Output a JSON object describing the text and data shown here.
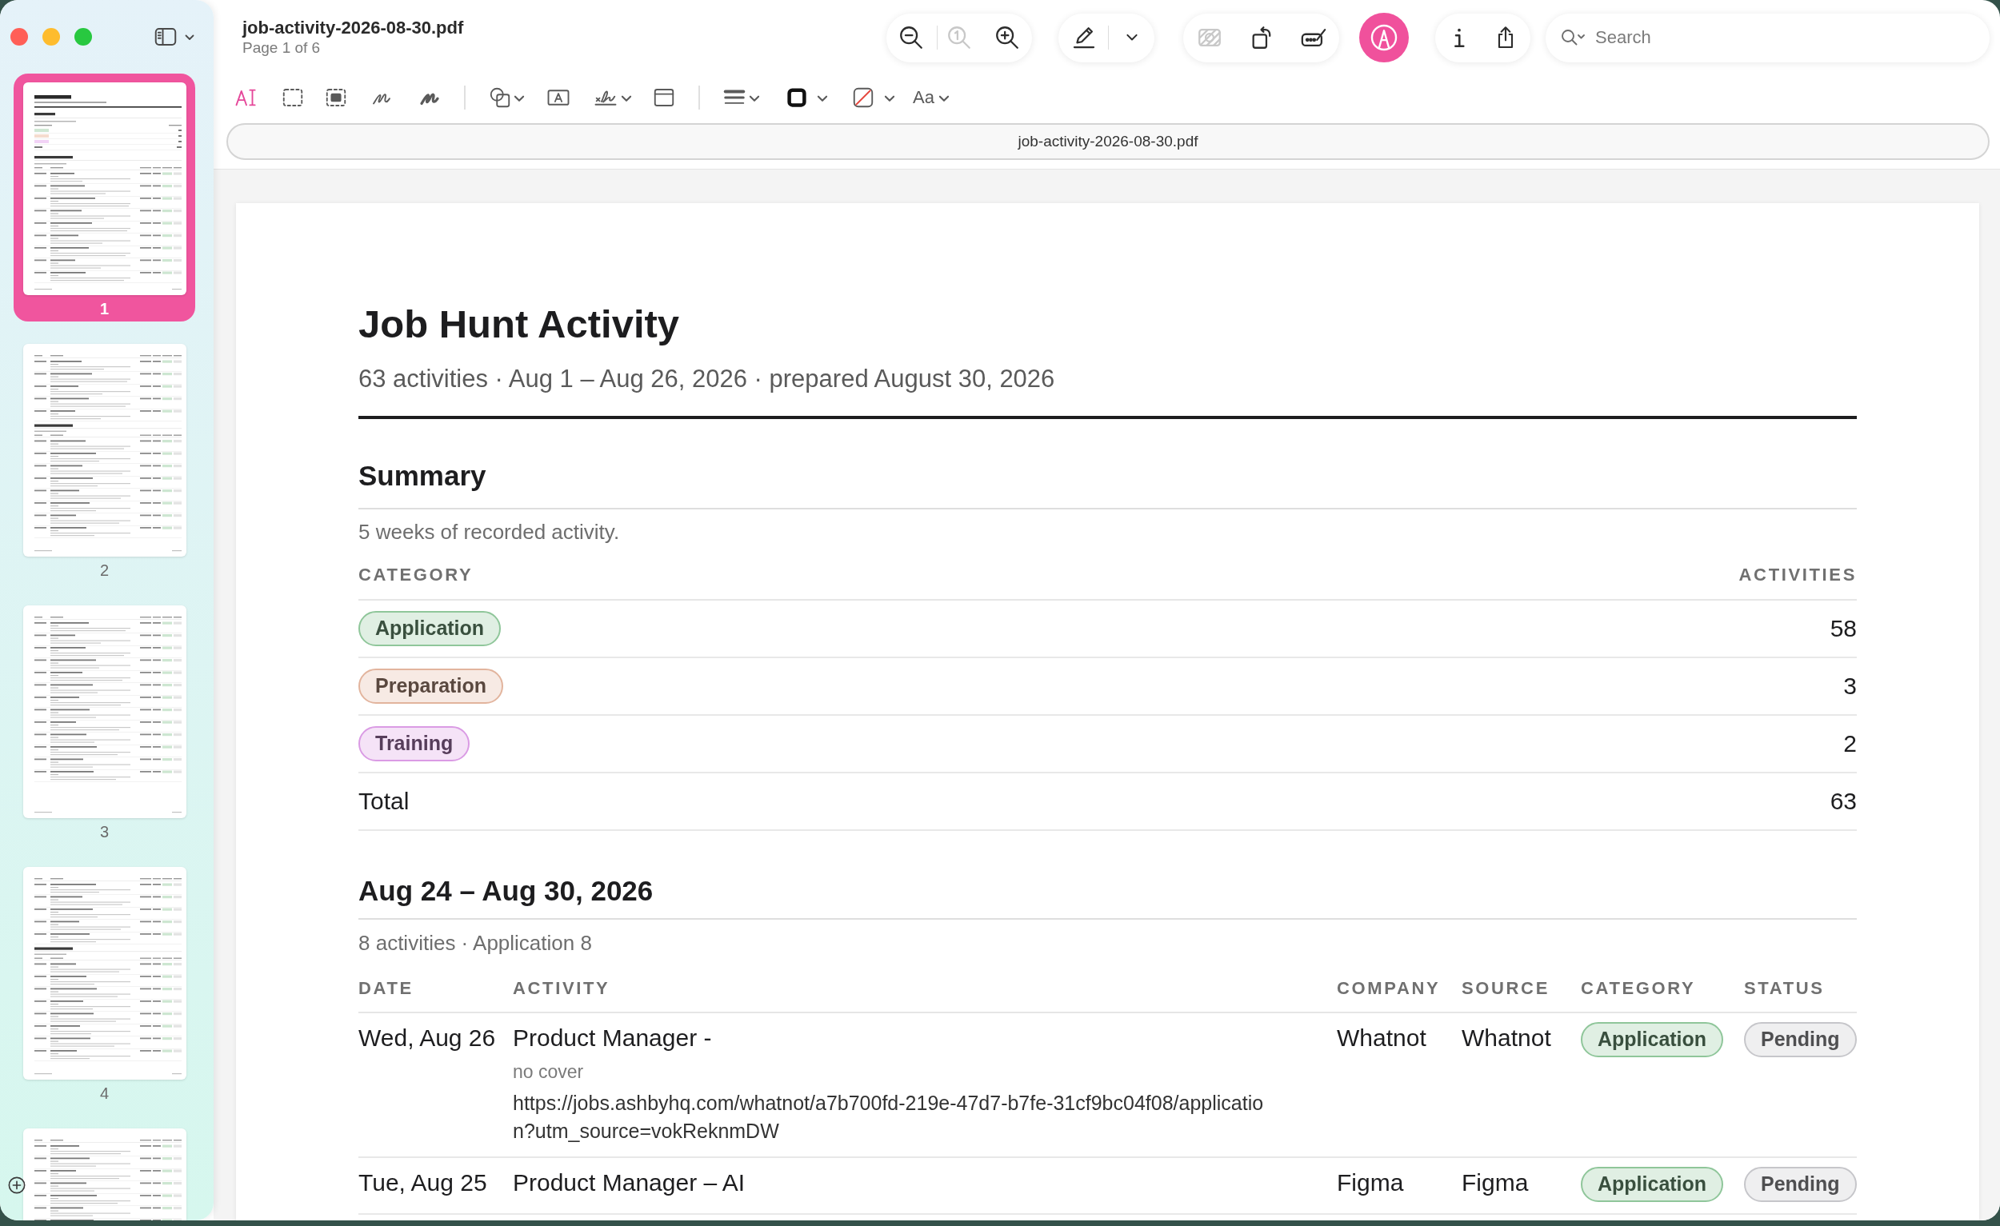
{
  "window": {
    "title": "job-activity-2026-08-30.pdf",
    "page_indicator": "Page 1 of 6"
  },
  "sidebar": {
    "pages": [
      {
        "label": "1",
        "selected": true
      },
      {
        "label": "2",
        "selected": false
      },
      {
        "label": "3",
        "selected": false
      },
      {
        "label": "4",
        "selected": false
      },
      {
        "selected": false
      }
    ]
  },
  "toolbar": {
    "zoom": [
      {
        "disabled": false
      },
      {
        "disabled": true
      },
      {
        "disabled": false
      }
    ],
    "edit": [
      {
        "disabled": true
      },
      {
        "disabled": false
      },
      {
        "disabled": false
      }
    ],
    "markup": {
      "on": true
    },
    "search": {
      "placeholder": "Search"
    }
  },
  "markup_toolbar": {
    "tools": [
      {
        "selected": true
      },
      {
        "selected": false
      },
      {
        "selected": false
      },
      {
        "selected": false
      },
      {
        "selected": false
      }
    ],
    "font_button": {
      "label": "Aa"
    }
  },
  "document": {
    "filename": "job-activity-2026-08-30.pdf",
    "title": "Job Hunt Activity",
    "subtitle": "63 activities · Aug 1 – Aug 26, 2026 · prepared August 30, 2026",
    "summary": {
      "heading": "Summary",
      "note": "5 weeks of recorded activity.",
      "columns": [
        "CATEGORY",
        "ACTIVITIES"
      ],
      "rows": [
        {
          "category": {
            "label": "Application",
            "color": "#8fc69a"
          },
          "count": "58"
        },
        {
          "category": {
            "label": "Preparation",
            "color": "#e2b49d"
          },
          "count": "3"
        },
        {
          "category": {
            "label": "Training",
            "color": "#da9be4"
          },
          "count": "2"
        }
      ],
      "total": {
        "label": "Total",
        "count": "63"
      }
    },
    "weeks": [
      {
        "heading": "Aug 24 – Aug 30, 2026",
        "note": "8 activities · Application 8",
        "columns": [
          "DATE",
          "ACTIVITY",
          "COMPANY",
          "SOURCE",
          "CATEGORY",
          "STATUS"
        ],
        "rows": [
          {
            "date": "Wed, Aug 26",
            "activity": "Product Manager -",
            "detail": "no cover",
            "url": "https://jobs.ashbyhq.com/whatnot/a7b700fd-219e-47d7-b7fe-31cf9bc04f08/application?utm_source=vokReknmDW",
            "company": "Whatnot",
            "source": "Whatnot",
            "category": {
              "label": "Application",
              "color": "#8fc69a"
            },
            "status": {
              "label": "Pending",
              "color": "#c6c6ca"
            }
          },
          {
            "date": "Tue, Aug 25",
            "activity": "Product Manager – AI",
            "company": "Figma",
            "source": "Figma",
            "category": {
              "label": "Application",
              "color": "#8fc69a"
            },
            "status": {
              "label": "Pending",
              "color": "#c6c6ca"
            }
          }
        ]
      }
    ]
  }
}
